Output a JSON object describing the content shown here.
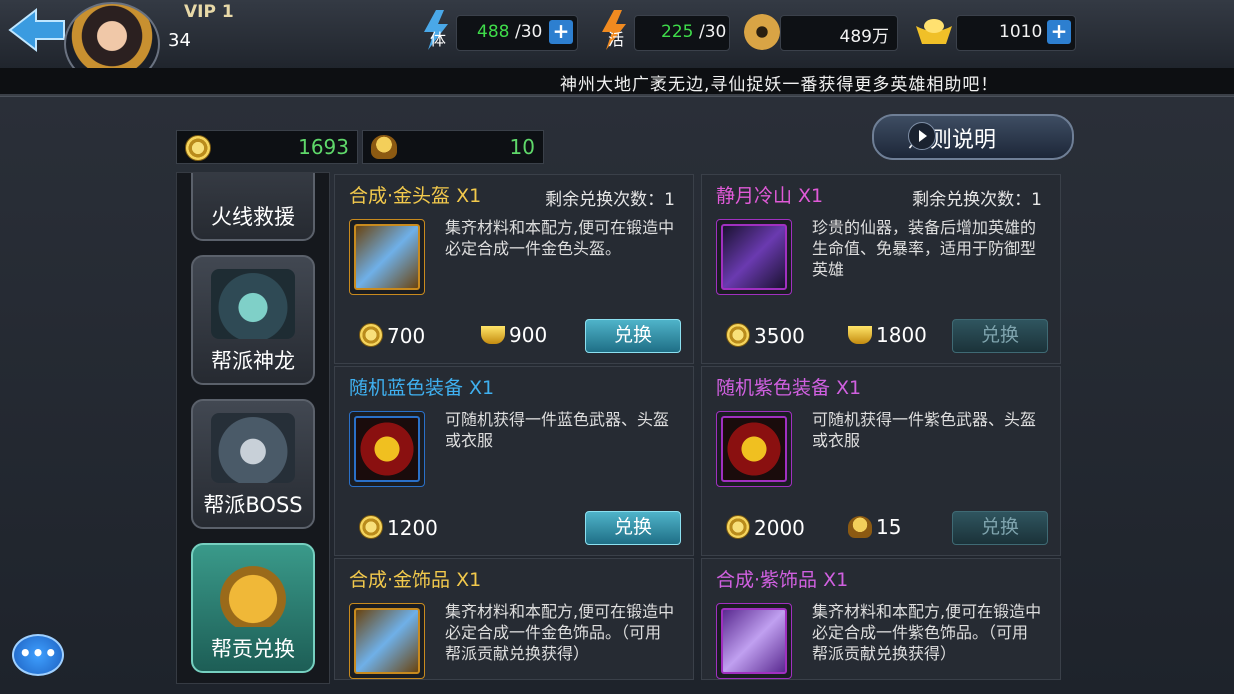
{
  "header": {
    "vip_label": "VIP 1",
    "player_level": "34",
    "stamina": {
      "label": "体",
      "value": "488",
      "max": "/30"
    },
    "vitality": {
      "label": "活",
      "value": "225",
      "max": "/30"
    },
    "copper": {
      "value": "489万"
    },
    "gold": {
      "value": "1010"
    },
    "plus": "+"
  },
  "ticker": "神州大地广袤无边,寻仙捉妖一番获得更多英雄相助吧！",
  "currencies": {
    "contribution": "1693",
    "boss_token": "10"
  },
  "rules_button": "规则说明",
  "sidebar": {
    "items": [
      {
        "label": "火线救援",
        "icon": "banner-icon"
      },
      {
        "label": "帮派神龙",
        "icon": "dragon-icon"
      },
      {
        "label": "帮派BOSS",
        "icon": "boss-icon"
      },
      {
        "label": "帮贡兑换",
        "icon": "money-bag-icon",
        "active": true
      }
    ]
  },
  "cards": [
    {
      "name": "合成·金头盔 X1",
      "name_color": "#f2c94c",
      "remain": "剩余兑换次数：1",
      "desc": "集齐材料和本配方,便可在锻造中必定合成一件金色头盔。",
      "icon": "gold-scroll-icon",
      "slot_color": "#c88a1e",
      "prices": [
        {
          "kind": "coin",
          "value": "700"
        },
        {
          "kind": "ingot",
          "value": "900"
        }
      ],
      "button": "兑换",
      "button_state": "on"
    },
    {
      "name": "静月冷山 X1",
      "name_color": "#e05ad8",
      "remain": "剩余兑换次数：1",
      "desc": "珍贵的仙器，装备后增加英雄的生命值、免暴率，适用于防御型英雄",
      "icon": "boot-icon",
      "slot_color": "#a030c0",
      "prices": [
        {
          "kind": "coin",
          "value": "3500"
        },
        {
          "kind": "ingot",
          "value": "1800"
        }
      ],
      "button": "兑换",
      "button_state": "off"
    },
    {
      "name": "随机蓝色装备 X1",
      "name_color": "#3fb0f0",
      "remain": "",
      "desc": "可随机获得一件蓝色武器、头盔或衣服",
      "icon": "mystery-box-icon",
      "slot_color": "#2a70c8",
      "prices": [
        {
          "kind": "coin",
          "value": "1200"
        }
      ],
      "button": "兑换",
      "button_state": "on"
    },
    {
      "name": "随机紫色装备 X1",
      "name_color": "#d060e0",
      "remain": "",
      "desc": "可随机获得一件紫色武器、头盔或衣服",
      "icon": "mystery-box-icon",
      "slot_color": "#a030c0",
      "prices": [
        {
          "kind": "coin",
          "value": "2000"
        },
        {
          "kind": "helm",
          "value": "15"
        }
      ],
      "button": "兑换",
      "button_state": "off"
    },
    {
      "name": "合成·金饰品 X1",
      "name_color": "#f2c94c",
      "remain": "",
      "desc": "集齐材料和本配方,便可在锻造中必定合成一件金色饰品。（可用帮派贡献兑换获得）",
      "icon": "gold-scroll-icon",
      "slot_color": "#c88a1e",
      "prices": [],
      "button": "",
      "button_state": "none"
    },
    {
      "name": "合成·紫饰品 X1",
      "name_color": "#d060e0",
      "remain": "",
      "desc": "集齐材料和本配方,便可在锻造中必定合成一件紫色饰品。（可用帮派贡献兑换获得）",
      "icon": "purple-scroll-icon",
      "slot_color": "#a030c0",
      "prices": [],
      "button": "",
      "button_state": "none"
    }
  ],
  "chat_button": "•••"
}
